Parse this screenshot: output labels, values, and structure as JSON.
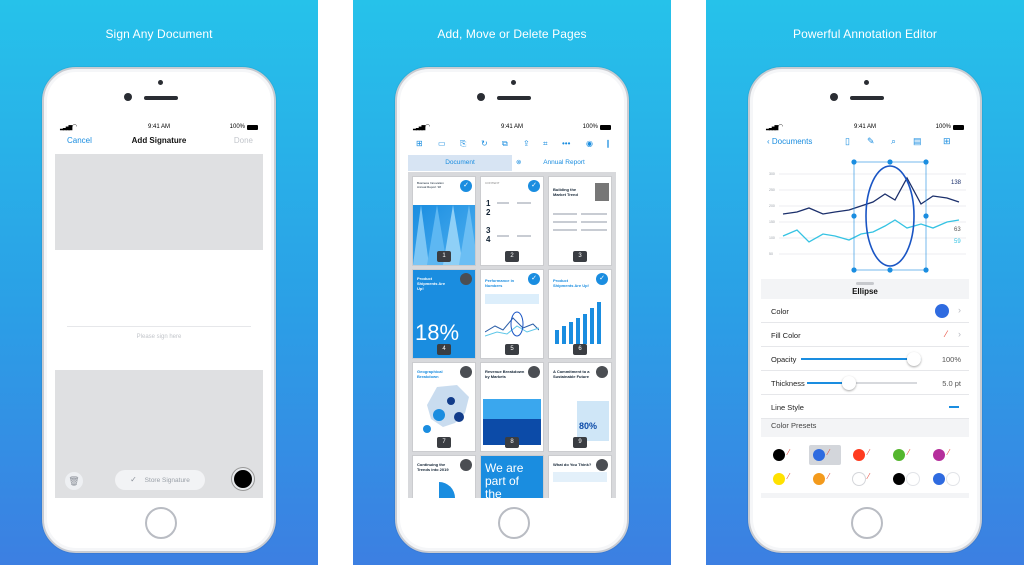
{
  "panels": [
    {
      "title": "Sign Any Document"
    },
    {
      "title": "Add, Move or Delete Pages"
    },
    {
      "title": "Powerful Annotation Editor"
    }
  ],
  "status": {
    "time": "9:41 AM",
    "battery": "100%"
  },
  "sign": {
    "cancel": "Cancel",
    "title": "Add Signature",
    "done": "Done",
    "placeholder": "Please sign here",
    "store": "Store Signature",
    "selected_color": "#000000"
  },
  "pages": {
    "tabs": [
      "Document",
      "Annual Report"
    ],
    "toolbar_icons": [
      "add-page-icon",
      "add-blank-icon",
      "insert-icon",
      "rotate-icon",
      "duplicate-icon",
      "export-icon",
      "crop-icon",
      "more-icon",
      "select-all-icon",
      "sidebar-icon"
    ],
    "thumbs": [
      {
        "n": "1",
        "checked": true,
        "text": "Business Innovation Annual Report '18"
      },
      {
        "n": "2",
        "checked": true,
        "text": "CONTENT"
      },
      {
        "n": "3",
        "checked": false,
        "text": "Building the Market Trend"
      },
      {
        "n": "4",
        "checked": false,
        "text": "Product Shipments Are Up!",
        "big": "18%"
      },
      {
        "n": "5",
        "checked": true,
        "text": "Performance in Numbers"
      },
      {
        "n": "6",
        "checked": true,
        "text": "Product Shipments Are Up!"
      },
      {
        "n": "7",
        "checked": false,
        "text": "Geographical Breakdown"
      },
      {
        "n": "8",
        "checked": false,
        "text": "Revenue Breakdown by Markets"
      },
      {
        "n": "9",
        "checked": false,
        "text": "A Commitment to a Sustainable Future",
        "big": "80%"
      },
      {
        "n": "",
        "checked": false,
        "text": "Continuing the Trends into 2019"
      },
      {
        "n": "",
        "checked": false,
        "text": "",
        "big": "We are part of the"
      },
      {
        "n": "",
        "checked": false,
        "text": "What do You Think?"
      }
    ]
  },
  "annot": {
    "back": "Documents",
    "chart_labels": {
      "a": "138",
      "b": "63",
      "c": "59"
    },
    "sheet_title": "Ellipse",
    "rows": {
      "color": "Color",
      "fill": "Fill Color",
      "opacity": "Opacity",
      "opacity_value": "100%",
      "opacity_level": 1.0,
      "thickness": "Thickness",
      "thickness_value": "5.0 pt",
      "thickness_level": 0.38,
      "line_style": "Line Style"
    },
    "presets_label": "Color Presets",
    "accent": "#2f6be0",
    "presets": [
      {
        "color": "#000000",
        "fill": "none"
      },
      {
        "color": "#2f6be0",
        "fill": "none",
        "selected": true
      },
      {
        "color": "#ff3b1f",
        "fill": "none"
      },
      {
        "color": "#55b62f",
        "fill": "none"
      },
      {
        "color": "#b52f9c",
        "fill": "none"
      },
      {
        "color": "#ffe100",
        "fill": "none"
      },
      {
        "color": "#f39a1c",
        "fill": "none"
      },
      {
        "color": "#ffffff",
        "fill": "none"
      },
      {
        "color": "#000000",
        "fill": "solid"
      },
      {
        "color": "#2f6be0",
        "fill": "solid"
      }
    ]
  }
}
